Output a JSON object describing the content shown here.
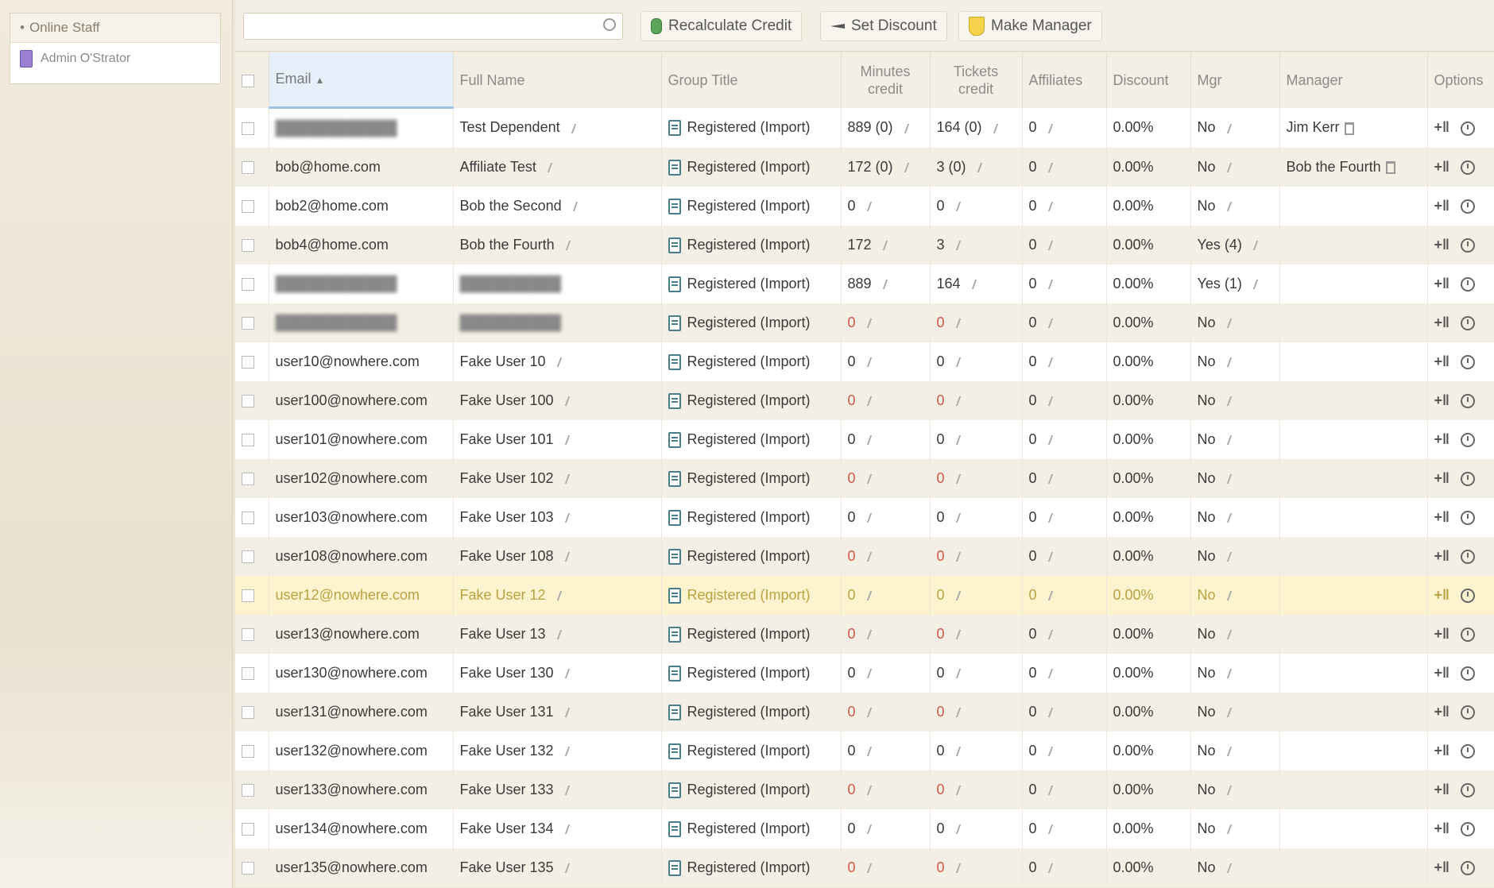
{
  "sidebar": {
    "header": "Online Staff",
    "items": [
      {
        "label": "Admin O'Strator"
      }
    ]
  },
  "toolbar": {
    "search_placeholder": "",
    "buttons": [
      {
        "label": "Recalculate Credit",
        "icon": "coin-icon"
      },
      {
        "label": "Set Discount",
        "icon": "scissors-icon"
      },
      {
        "label": "Make Manager",
        "icon": "shield-icon"
      }
    ]
  },
  "columns": [
    "Email",
    "Full Name",
    "Group Title",
    "Minutes credit",
    "Tickets credit",
    "Affiliates",
    "Discount",
    "Mgr",
    "Manager",
    "Options"
  ],
  "sort": {
    "column": "Email",
    "direction": "ascending",
    "indicator": "▲"
  },
  "rows": [
    {
      "email": "",
      "name": "Test Dependent",
      "group": "Registered (Import)",
      "minutes": "889 (0)",
      "tickets": "164 (0)",
      "affiliates": "0",
      "discount": "0.00%",
      "mgr": "No",
      "manager": "Jim Kerr",
      "red": false,
      "highlight": false,
      "blur_email": true,
      "blur_name": false
    },
    {
      "email": "bob@home.com",
      "name": "Affiliate Test",
      "group": "Registered (Import)",
      "minutes": "172 (0)",
      "tickets": "3 (0)",
      "affiliates": "0",
      "discount": "0.00%",
      "mgr": "No",
      "manager": "Bob the Fourth",
      "red": false,
      "highlight": false
    },
    {
      "email": "bob2@home.com",
      "name": "Bob the Second",
      "group": "Registered (Import)",
      "minutes": "0",
      "tickets": "0",
      "affiliates": "0",
      "discount": "0.00%",
      "mgr": "No",
      "manager": "",
      "red": false,
      "highlight": false
    },
    {
      "email": "bob4@home.com",
      "name": "Bob the Fourth",
      "group": "Registered (Import)",
      "minutes": "172",
      "tickets": "3",
      "affiliates": "0",
      "discount": "0.00%",
      "mgr": "Yes (4)",
      "manager": "",
      "red": false,
      "highlight": false
    },
    {
      "email": "",
      "name": "",
      "group": "Registered (Import)",
      "minutes": "889",
      "tickets": "164",
      "affiliates": "0",
      "discount": "0.00%",
      "mgr": "Yes (1)",
      "manager": "",
      "red": false,
      "highlight": false,
      "blur_email": true,
      "blur_name": true
    },
    {
      "email": "",
      "name": "",
      "group": "Registered (Import)",
      "minutes": "0",
      "tickets": "0",
      "affiliates": "0",
      "discount": "0.00%",
      "mgr": "No",
      "manager": "",
      "red": true,
      "highlight": false,
      "blur_email": true,
      "blur_name": true
    },
    {
      "email": "user10@nowhere.com",
      "name": "Fake User 10",
      "group": "Registered (Import)",
      "minutes": "0",
      "tickets": "0",
      "affiliates": "0",
      "discount": "0.00%",
      "mgr": "No",
      "manager": "",
      "red": false,
      "highlight": false
    },
    {
      "email": "user100@nowhere.com",
      "name": "Fake User 100",
      "group": "Registered (Import)",
      "minutes": "0",
      "tickets": "0",
      "affiliates": "0",
      "discount": "0.00%",
      "mgr": "No",
      "manager": "",
      "red": true,
      "highlight": false
    },
    {
      "email": "user101@nowhere.com",
      "name": "Fake User 101",
      "group": "Registered (Import)",
      "minutes": "0",
      "tickets": "0",
      "affiliates": "0",
      "discount": "0.00%",
      "mgr": "No",
      "manager": "",
      "red": false,
      "highlight": false
    },
    {
      "email": "user102@nowhere.com",
      "name": "Fake User 102",
      "group": "Registered (Import)",
      "minutes": "0",
      "tickets": "0",
      "affiliates": "0",
      "discount": "0.00%",
      "mgr": "No",
      "manager": "",
      "red": true,
      "highlight": false
    },
    {
      "email": "user103@nowhere.com",
      "name": "Fake User 103",
      "group": "Registered (Import)",
      "minutes": "0",
      "tickets": "0",
      "affiliates": "0",
      "discount": "0.00%",
      "mgr": "No",
      "manager": "",
      "red": false,
      "highlight": false
    },
    {
      "email": "user108@nowhere.com",
      "name": "Fake User 108",
      "group": "Registered (Import)",
      "minutes": "0",
      "tickets": "0",
      "affiliates": "0",
      "discount": "0.00%",
      "mgr": "No",
      "manager": "",
      "red": true,
      "highlight": false
    },
    {
      "email": "user12@nowhere.com",
      "name": "Fake User 12",
      "group": "Registered (Import)",
      "minutes": "0",
      "tickets": "0",
      "affiliates": "0",
      "discount": "0.00%",
      "mgr": "No",
      "manager": "",
      "red": true,
      "highlight": true
    },
    {
      "email": "user13@nowhere.com",
      "name": "Fake User 13",
      "group": "Registered (Import)",
      "minutes": "0",
      "tickets": "0",
      "affiliates": "0",
      "discount": "0.00%",
      "mgr": "No",
      "manager": "",
      "red": true,
      "highlight": false
    },
    {
      "email": "user130@nowhere.com",
      "name": "Fake User 130",
      "group": "Registered (Import)",
      "minutes": "0",
      "tickets": "0",
      "affiliates": "0",
      "discount": "0.00%",
      "mgr": "No",
      "manager": "",
      "red": false,
      "highlight": false
    },
    {
      "email": "user131@nowhere.com",
      "name": "Fake User 131",
      "group": "Registered (Import)",
      "minutes": "0",
      "tickets": "0",
      "affiliates": "0",
      "discount": "0.00%",
      "mgr": "No",
      "manager": "",
      "red": true,
      "highlight": false
    },
    {
      "email": "user132@nowhere.com",
      "name": "Fake User 132",
      "group": "Registered (Import)",
      "minutes": "0",
      "tickets": "0",
      "affiliates": "0",
      "discount": "0.00%",
      "mgr": "No",
      "manager": "",
      "red": false,
      "highlight": false
    },
    {
      "email": "user133@nowhere.com",
      "name": "Fake User 133",
      "group": "Registered (Import)",
      "minutes": "0",
      "tickets": "0",
      "affiliates": "0",
      "discount": "0.00%",
      "mgr": "No",
      "manager": "",
      "red": true,
      "highlight": false
    },
    {
      "email": "user134@nowhere.com",
      "name": "Fake User 134",
      "group": "Registered (Import)",
      "minutes": "0",
      "tickets": "0",
      "affiliates": "0",
      "discount": "0.00%",
      "mgr": "No",
      "manager": "",
      "red": false,
      "highlight": false
    },
    {
      "email": "user135@nowhere.com",
      "name": "Fake User 135",
      "group": "Registered (Import)",
      "minutes": "0",
      "tickets": "0",
      "affiliates": "0",
      "discount": "0.00%",
      "mgr": "No",
      "manager": "",
      "red": true,
      "highlight": false
    }
  ],
  "colors": {
    "accent": "#9fc3e4",
    "highlight_row": "#fdf3cf",
    "negative": "#d0584a",
    "header_bg": "#f4efe5"
  }
}
